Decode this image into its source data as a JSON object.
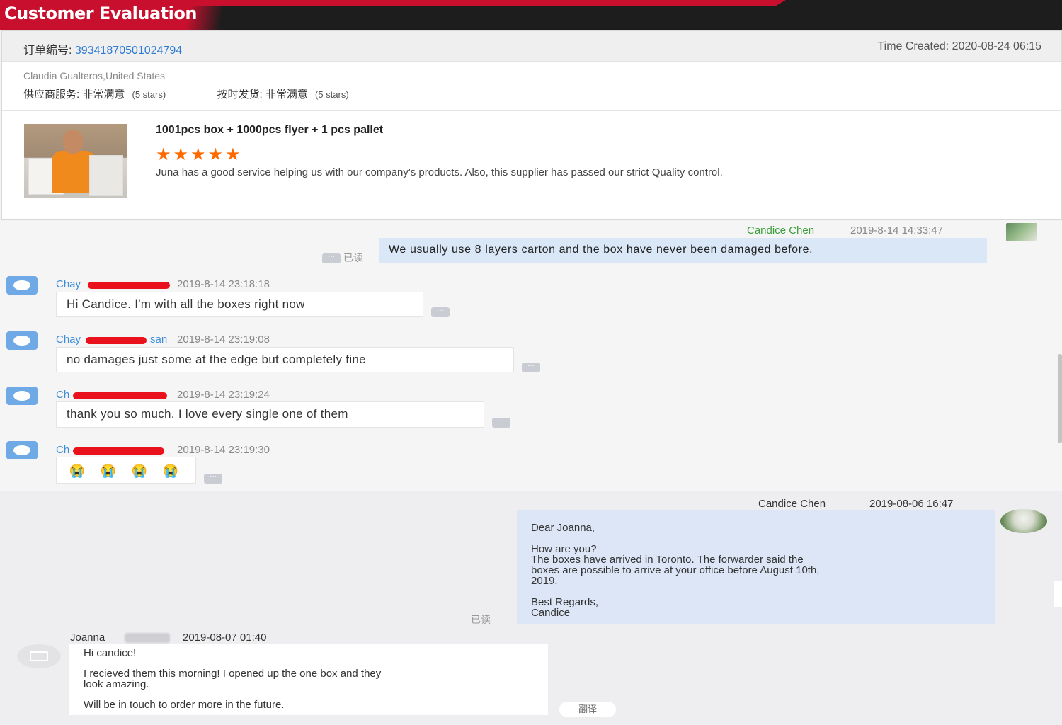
{
  "header": {
    "title": "Customer Evaluation"
  },
  "evaluation": {
    "order_label": "订单编号:",
    "order_id": "393418705010247 94",
    "time_created": "Time Created: 2020-08-24 06:15",
    "buyer": "Claudia Gualteros,United States",
    "supplier_service_label": "供应商服务: 非常满意",
    "supplier_service_stars": "(5 stars)",
    "on_time_label": "按时发货: 非常满意",
    "on_time_stars": "(5 stars)",
    "product_title": "1001pcs box + 1000pcs flyer + 1 pcs pallet",
    "stars": "★★★★★",
    "comment": "Juna has a good service helping us with  our company's products. Also, this supplier has passed our strict Quality control."
  },
  "chat1": {
    "seller_name": "Candice Chen",
    "seller_time": "2019-8-14 14:33:47",
    "seller_message": "We usually use 8 layers carton and the box have never been damaged before.",
    "read_label": "已读",
    "dots": "···",
    "messages": [
      {
        "name": "Chay",
        "time": "2019-8-14 23:18:18",
        "text": "Hi Candice. I'm with all the boxes right now"
      },
      {
        "name": "Chay",
        "name_tail": "san",
        "time": "2019-8-14 23:19:08",
        "text": "no damages just some at the edge but completely fine"
      },
      {
        "name": "Ch",
        "time": "2019-8-14 23:19:24",
        "text": "thank you so much. I love every single one of them"
      },
      {
        "name": "Ch",
        "time": "2019-8-14 23:19:30",
        "emojis": [
          "😭",
          "😭",
          "😭",
          "😭"
        ]
      }
    ]
  },
  "chat2": {
    "seller_name": "Candice Chen",
    "seller_time": "2019-08-06 16:47",
    "letter": {
      "greeting": "Dear Joanna,",
      "line1": "How are you?",
      "line2": "The boxes have arrived in Toronto. The forwarder said the",
      "line3": "boxes are possible to arrive at your office before August 10th,",
      "line4": "2019.",
      "closing": "Best Regards,",
      "signature": "Candice"
    },
    "read_label": "已读",
    "buyer_name": "Joanna",
    "buyer_time": "2019-08-07 01:40",
    "reply": {
      "line1": "Hi candice!",
      "line2": "I recieved them this morning! I opened up the one box and they",
      "line3": "look amazing.",
      "line4": "Will be in touch to order more in the future."
    },
    "translate_label": "翻译"
  }
}
